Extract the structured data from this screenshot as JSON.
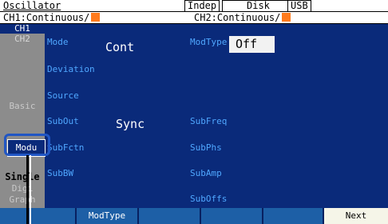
{
  "header": {
    "title": "Oscillator",
    "mode_label": "Indep",
    "disk_label": "Disk",
    "usb_label": "USB",
    "ch1_status": "CH1:Continuous/",
    "ch2_status": "CH2:Continuous/"
  },
  "tabs": {
    "ch1": "CH1",
    "ch2": "CH2",
    "basic": "Basic",
    "modu": "Modu",
    "single": "Single",
    "digi": "Digi",
    "graph": "Graph"
  },
  "params": {
    "mode_label": "Mode",
    "mode_value": "Cont",
    "deviation_label": "Deviation",
    "source_label": "Source",
    "subout_label": "SubOut",
    "subout_value": "Sync",
    "subfctn_label": "SubFctn",
    "subbw_label": "SubBW",
    "modtype_label": "ModType",
    "modtype_value": "Off",
    "subfreq_label": "SubFreq",
    "subphs_label": "SubPhs",
    "subamp_label": "SubAmp",
    "suboffs_label": "SubOffs"
  },
  "softkeys": {
    "key1": "",
    "key2": "ModType",
    "key3": "",
    "key4": "",
    "key5": "",
    "next": "Next"
  },
  "colors": {
    "screen_bg": "#0a2a7a",
    "label_blue": "#4fa7ff",
    "channel_swatch": "#ff7a1c",
    "softkey_bg": "#1d5fa6",
    "highlight": "#2156c4"
  }
}
